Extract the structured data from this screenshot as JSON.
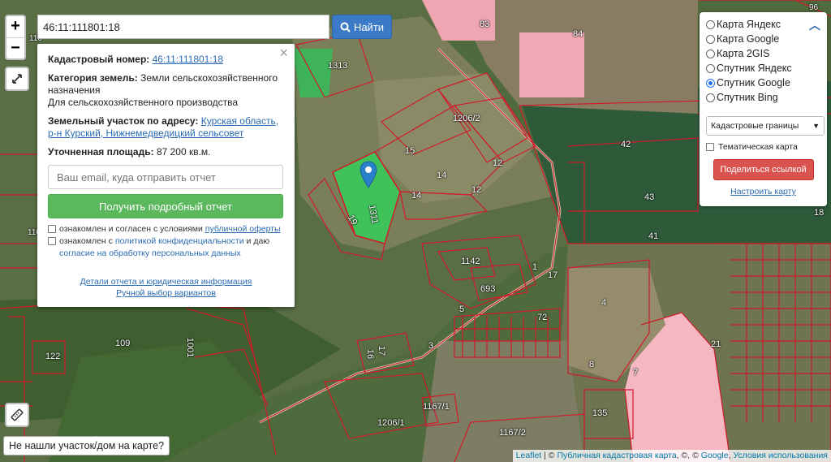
{
  "search": {
    "value": "46:11:111801:18",
    "button_label": "Найти"
  },
  "zoom": {
    "in_label": "+",
    "out_label": "−"
  },
  "popup": {
    "close_label": "×",
    "cadastral_label": "Кадастровый номер:",
    "cadastral_value": "46:11:111801:18",
    "category_label": "Категория земель:",
    "category_value": "Земли сельскохозяйственного назначения",
    "use_value": "Для сельскохозяйственного производства",
    "address_label": "Земельный участок по адресу:",
    "address_value": "Курская область, р-н Курский, Нижнемедведицкий сельсовет",
    "area_label": "Уточненная площадь:",
    "area_value": "87 200 кв.м.",
    "email_placeholder": "Ваш email, куда отправить отчет",
    "report_button": "Получить подробный отчет",
    "consent1_text": "ознакомлен и согласен с условиями",
    "consent1_link": "публичной оферты",
    "consent2_text": "ознакомлен с",
    "consent2_link1": "политикой конфиденциальности",
    "consent2_mid": "и даю",
    "consent2_link2": "согласие на обработку персональных данных",
    "details_link": "Детали отчета и юридическая информация",
    "manual_link": "Ручной выбор вариантов"
  },
  "layers": {
    "options": [
      {
        "label": "Карта Яндекс",
        "selected": false
      },
      {
        "label": "Карта Google",
        "selected": false
      },
      {
        "label": "Карта 2GIS",
        "selected": false
      },
      {
        "label": "Спутник Яндекс",
        "selected": false
      },
      {
        "label": "Спутник Google",
        "selected": true
      },
      {
        "label": "Спутник Bing",
        "selected": false
      }
    ],
    "select_value": "Кадастровые границы",
    "thematic_label": "Тематическая карта",
    "share_button": "Поделиться ссылкой",
    "setup_link": "Настроить карту"
  },
  "notfound_label": "Не нашли участок/дом на карте?",
  "attribution": {
    "leaflet": "Leaflet",
    "sep1": " | © ",
    "pkk": "Публичная кадастровая карта",
    "sep2": ", ©, © ",
    "google": "Google",
    "sep3": ", ",
    "terms": "Условия использования"
  },
  "plot_labels": [
    "1313",
    "83",
    "84",
    "96",
    "1206/2",
    "15",
    "14",
    "12",
    "14",
    "12",
    "19",
    "1311",
    "42",
    "43",
    "18",
    "41",
    "1142",
    "1",
    "693",
    "17",
    "5",
    "72",
    "4",
    "109",
    "122",
    "1001",
    "16",
    "17",
    "3",
    "8",
    "7",
    "21",
    "1167/1",
    "1206/1",
    "135",
    "1167/2",
    "110",
    "110",
    "1107"
  ],
  "colors": {
    "accent_blue": "#3b7ac6",
    "green_button": "#5cb85c",
    "red_button": "#d9534f",
    "parcel_red": "#d11a2a",
    "selected_parcel": "#3fc25a"
  }
}
